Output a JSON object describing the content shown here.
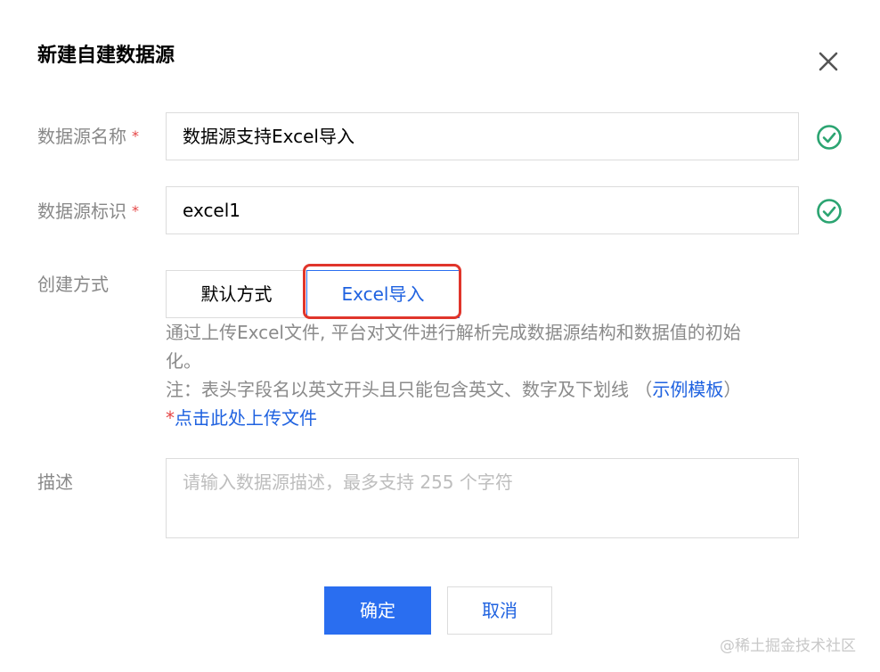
{
  "dialog": {
    "title": "新建自建数据源",
    "close_icon": "close-icon"
  },
  "fields": {
    "name": {
      "label": "数据源名称",
      "required_mark": "*",
      "value": "数据源支持Excel导入",
      "status_icon": "check-circle-icon"
    },
    "identifier": {
      "label": "数据源标识",
      "required_mark": "*",
      "value": "excel1",
      "status_icon": "check-circle-icon"
    },
    "create_mode": {
      "label": "创建方式",
      "options": [
        "默认方式",
        "Excel导入"
      ],
      "selected": "Excel导入",
      "help_line1": "通过上传Excel文件, 平台对文件进行解析完成数据源结构和数据值的初始",
      "help_line2": "化。",
      "note_prefix": "注：表头字段名以英文开头且只能包含英文、数字及下划线 （",
      "note_link": "示例模板",
      "note_suffix": "）",
      "upload_star": "*",
      "upload_link": "点击此处上传文件"
    },
    "description": {
      "label": "描述",
      "placeholder": "请输入数据源描述，最多支持 255 个字符",
      "value": ""
    }
  },
  "buttons": {
    "confirm": "确定",
    "cancel": "取消"
  },
  "watermark": "@稀土掘金技术社区",
  "colors": {
    "primary": "#2a6ef0",
    "success": "#2ba471",
    "required": "#e54545",
    "highlight": "#e0352b"
  }
}
